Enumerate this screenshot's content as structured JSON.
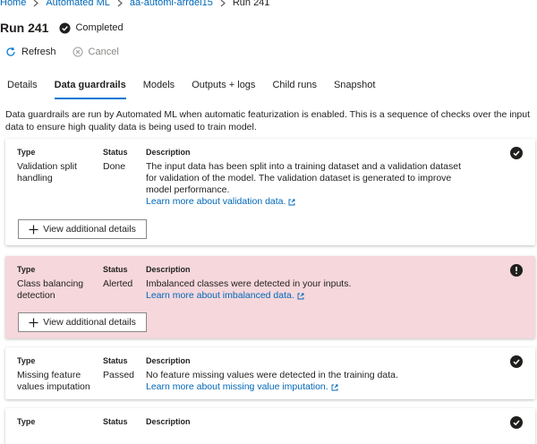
{
  "breadcrumb": [
    "Home",
    "Automated ML",
    "aa-automl-arrdel15",
    "Run 241"
  ],
  "run": {
    "title": "Run 241",
    "status": "Completed"
  },
  "commands": {
    "refresh": "Refresh",
    "cancel": "Cancel"
  },
  "tabs": [
    "Details",
    "Data guardrails",
    "Models",
    "Outputs + logs",
    "Child runs",
    "Snapshot"
  ],
  "active_tab": "Data guardrails",
  "description": "Data guardrails are run by Automated ML when automatic featurization is enabled. This is a sequence of checks over the input data to ensure high quality data is being used to train model.",
  "columns": {
    "type": "Type",
    "status": "Status",
    "description": "Description"
  },
  "view_button": "View additional details",
  "guardrails": [
    {
      "type": "Validation split handling",
      "status": "Done",
      "description": "The input data has been split into a training dataset and a validation dataset for validation of the model. The validation dataset is generated to improve model performance.",
      "link": "Learn more about validation data.",
      "state": "done"
    },
    {
      "type": "Class balancing detection",
      "status": "Alerted",
      "description": "Imbalanced classes were detected in your inputs.",
      "link": "Learn more about imbalanced data.",
      "state": "alerted"
    },
    {
      "type": "Missing feature values imputation",
      "status": "Passed",
      "description": "No feature missing values were detected in the training data.",
      "link": "Learn more about missing value imputation.",
      "state": "passed"
    },
    {
      "type": "",
      "status": "",
      "description": "",
      "link": "",
      "state": "passed"
    }
  ],
  "colors": {
    "accent": "#0078d4",
    "link": "#0067b8",
    "alert_bg": "#f5d7dc",
    "ok": "#201f1e"
  }
}
